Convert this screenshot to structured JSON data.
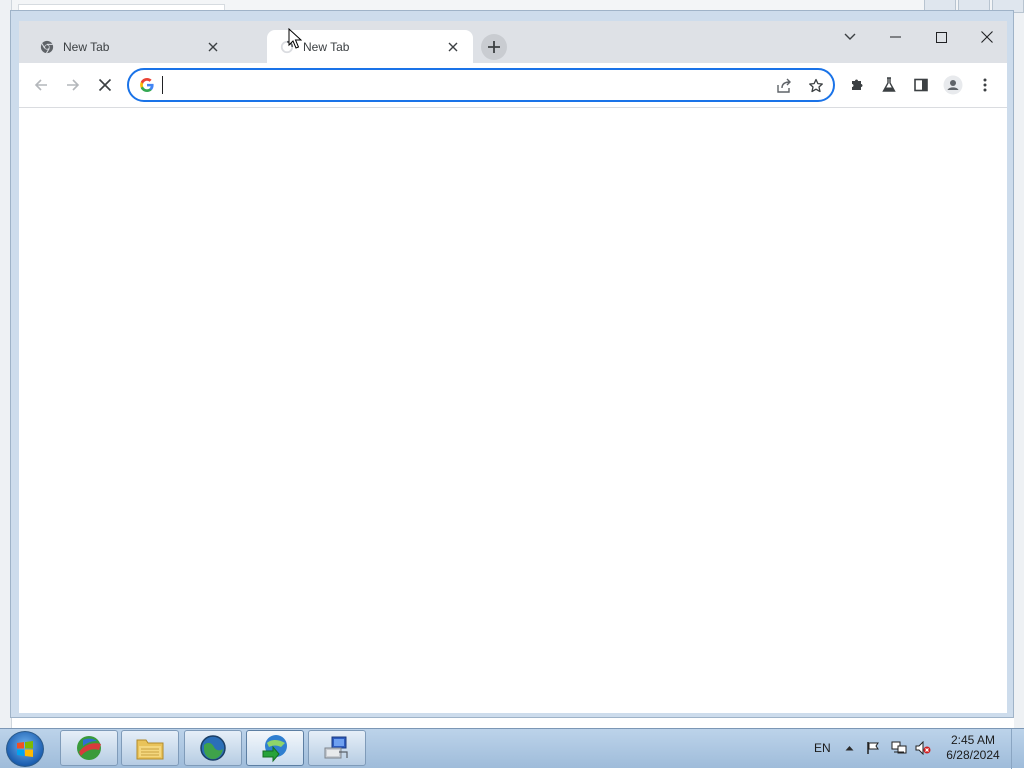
{
  "browser": {
    "tabs": [
      {
        "title": "New Tab",
        "active": false,
        "favicon": "chrome-icon"
      },
      {
        "title": "New Tab",
        "active": true,
        "favicon": "loading-spinner-icon"
      }
    ],
    "new_tab_icon": "plus-icon",
    "window_controls": [
      "chevron-down-icon",
      "minimize-icon",
      "maximize-icon",
      "close-icon"
    ],
    "toolbar": {
      "back_icon": "back-arrow-icon",
      "forward_icon": "forward-arrow-icon",
      "stop_icon": "stop-icon",
      "address_value": "",
      "address_placeholder": "",
      "omnibox_icons": [
        "share-icon",
        "bookmark-star-icon"
      ],
      "right_icons": [
        "extensions-puzzle-icon",
        "labs-flask-icon",
        "side-panel-icon",
        "profile-avatar-icon",
        "more-menu-icon"
      ]
    },
    "accent_color": "#1a73e8"
  },
  "taskbar": {
    "apps": [
      "orb-app-icon",
      "file-explorer-icon",
      "globe-browser-icon",
      "download-manager-icon",
      "network-computer-icon"
    ],
    "tray": {
      "language": "EN",
      "icons": [
        "show-hidden-icons",
        "action-center-flag-icon",
        "network-icon",
        "volume-muted-icon"
      ]
    },
    "clock": {
      "time": "2:45 AM",
      "date": "6/28/2024"
    }
  }
}
